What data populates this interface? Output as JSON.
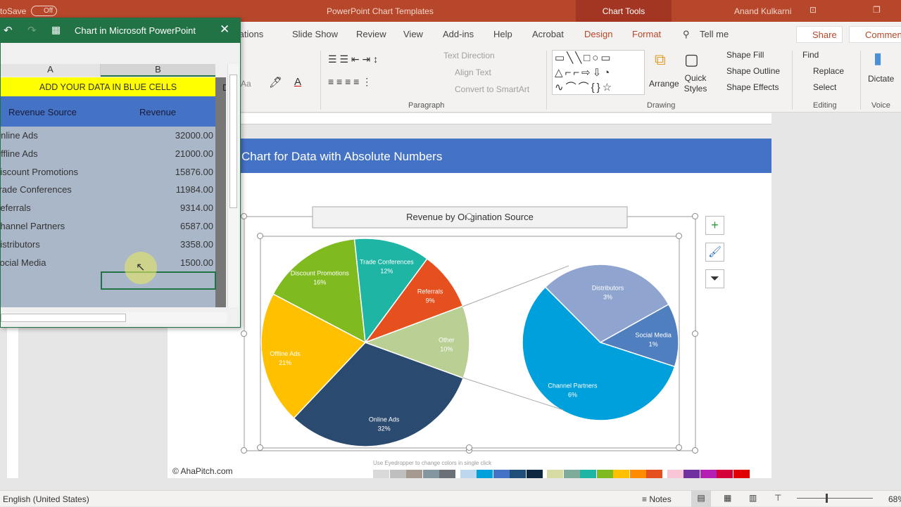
{
  "titlebar": {
    "autosave": "toSave",
    "autosave_state": "Off",
    "doc_title": "PowerPoint Chart Templates",
    "context_tab": "Chart Tools",
    "user": "Anand Kulkarni"
  },
  "tabs": [
    {
      "label": "Animations"
    },
    {
      "label": "Slide Show"
    },
    {
      "label": "Review"
    },
    {
      "label": "View"
    },
    {
      "label": "Add-ins"
    },
    {
      "label": "Help"
    },
    {
      "label": "Acrobat"
    },
    {
      "label": "Design"
    },
    {
      "label": "Format"
    }
  ],
  "tell_me": "Tell me",
  "share": "Share",
  "comments": "Comments",
  "ribbon": {
    "text_direction": "Text Direction",
    "align_text": "Align Text",
    "convert_smartart": "Convert to SmartArt",
    "paragraph": "Paragraph",
    "arrange": "Arrange",
    "quick_styles": "Quick Styles",
    "shape_fill": "Shape Fill",
    "shape_outline": "Shape Outline",
    "shape_effects": "Shape Effects",
    "drawing": "Drawing",
    "find": "Find",
    "replace": "Replace",
    "select": "Select",
    "editing": "Editing",
    "dictate": "Dictate",
    "voice": "Voice",
    "font_case": "Aa"
  },
  "excel": {
    "title": "Chart in Microsoft PowerPoint",
    "col_a": "A",
    "col_b": "B",
    "col_c": "D",
    "banner": "ADD YOUR DATA IN BLUE CELLS",
    "header_source": "Revenue Source",
    "header_revenue": "Revenue",
    "rows": [
      {
        "source": "Online Ads",
        "revenue": "32000.00"
      },
      {
        "source": "Offline Ads",
        "revenue": "21000.00"
      },
      {
        "source": "Discount Promotions",
        "revenue": "15876.00"
      },
      {
        "source": "Trade Conferences",
        "revenue": "11984.00"
      },
      {
        "source": "Referrals",
        "revenue": "9314.00"
      },
      {
        "source": "Channel Partners",
        "revenue": "6587.00"
      },
      {
        "source": "Distributors",
        "revenue": "3358.00"
      },
      {
        "source": "Social Media",
        "revenue": "1500.00"
      }
    ]
  },
  "slide": {
    "heading": "Chart for Data with Absolute Numbers",
    "copyright": "© AhaPitch.com",
    "eyedropper_hint": "Use Eyedropper to change colors in single click",
    "palette": [
      "#d9d9d9",
      "#bfbfbf",
      "#a6998f",
      "#8497a0",
      "#6b6f76",
      "#bdd7ee",
      "#00a0dc",
      "#4472c4",
      "#1f4e79",
      "#0e2841",
      "#d6dca4",
      "#7fab9a",
      "#1fb5a5",
      "#7fba1f",
      "#ffc000",
      "#ff8c00",
      "#e5501e",
      "#f9c6d7",
      "#7030a0",
      "#b41fb4",
      "#d4003a",
      "#e00000"
    ]
  },
  "chart_data": {
    "type": "pie-of-pie",
    "title": "Revenue by Origination Source",
    "main": [
      {
        "label": "Online Ads",
        "value": 32000,
        "pct": "32%",
        "color": "#2b4a6f"
      },
      {
        "label": "Offline Ads",
        "value": 21000,
        "pct": "21%",
        "color": "#ffc000"
      },
      {
        "label": "Discount Promotions",
        "value": 15876,
        "pct": "16%",
        "color": "#7fba1f"
      },
      {
        "label": "Trade Conferences",
        "value": 11984,
        "pct": "12%",
        "color": "#1fb5a5"
      },
      {
        "label": "Referrals",
        "value": 9314,
        "pct": "9%",
        "color": "#e5501e"
      },
      {
        "label": "Other",
        "value": 11445,
        "pct": "10%",
        "color": "#b9cf94"
      }
    ],
    "secondary": [
      {
        "label": "Channel Partners",
        "value": 6587,
        "pct": "6%",
        "color": "#00a0dc"
      },
      {
        "label": "Distributors",
        "value": 3358,
        "pct": "3%",
        "color": "#8fa5cf"
      },
      {
        "label": "Social Media",
        "value": 1500,
        "pct": "1%",
        "color": "#4f7fbf"
      }
    ]
  },
  "status": {
    "language": "English (United States)",
    "notes": "Notes",
    "zoom": "68%"
  }
}
